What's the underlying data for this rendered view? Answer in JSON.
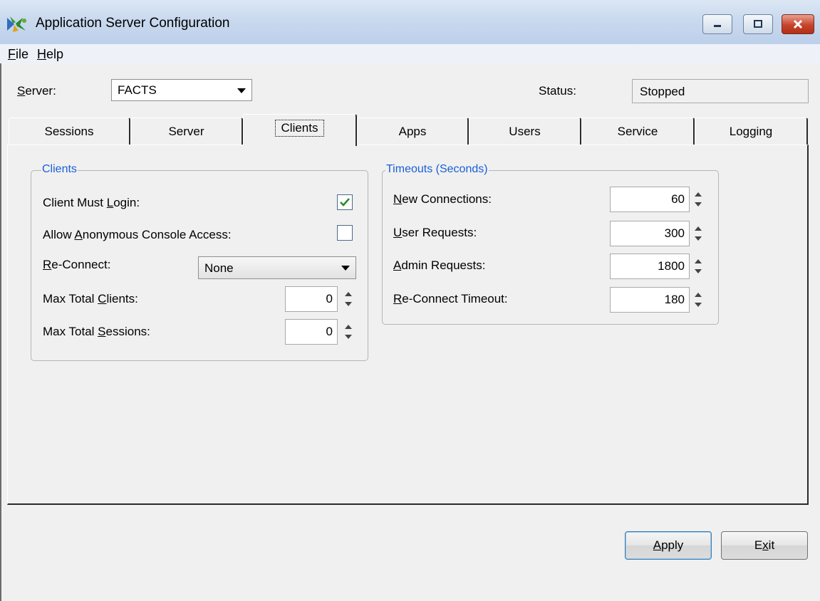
{
  "window": {
    "title": "Application Server Configuration",
    "icon": "server-app-icon"
  },
  "menu": {
    "file_prefix": "",
    "file_hotkey": "F",
    "file_rest": "ile",
    "help_hotkey": "H",
    "help_rest": "elp"
  },
  "server_row": {
    "server_hotkey": "S",
    "server_rest": "erver:",
    "server_value": "FACTS",
    "status_label": "Status:",
    "status_value": "Stopped"
  },
  "tabs": [
    {
      "label": "Sessions"
    },
    {
      "label": "Server"
    },
    {
      "label": "Clients",
      "active": true
    },
    {
      "label": "Apps"
    },
    {
      "label": "Users"
    },
    {
      "label": "Service"
    },
    {
      "label": "Logging"
    }
  ],
  "clients_group": {
    "title": "Clients",
    "must_login_pre": "Client Must ",
    "must_login_hotkey": "L",
    "must_login_post": "ogin:",
    "must_login_checked": true,
    "anon_pre": "Allow ",
    "anon_hotkey": "A",
    "anon_post": "nonymous Console Access:",
    "anon_checked": false,
    "reconnect_hotkey": "R",
    "reconnect_post": "e-Connect:",
    "reconnect_value": "None",
    "max_clients_pre": "Max Total ",
    "max_clients_hotkey": "C",
    "max_clients_post": "lients:",
    "max_clients_value": "0",
    "max_sessions_pre": "Max Total ",
    "max_sessions_hotkey": "S",
    "max_sessions_post": "essions:",
    "max_sessions_value": "0"
  },
  "timeouts_group": {
    "title": "Timeouts (Seconds)",
    "new_hotkey": "N",
    "new_post": "ew Connections:",
    "new_value": "60",
    "user_hotkey": "U",
    "user_post": "ser Requests:",
    "user_value": "300",
    "admin_hotkey": "A",
    "admin_post": "dmin Requests:",
    "admin_value": "1800",
    "reconnect_hotkey": "R",
    "reconnect_post": "e-Connect Timeout:",
    "reconnect_value": "180"
  },
  "buttons": {
    "apply_hotkey": "A",
    "apply_rest": "pply",
    "exit_pre": "E",
    "exit_hotkey": "x",
    "exit_rest": "it"
  }
}
